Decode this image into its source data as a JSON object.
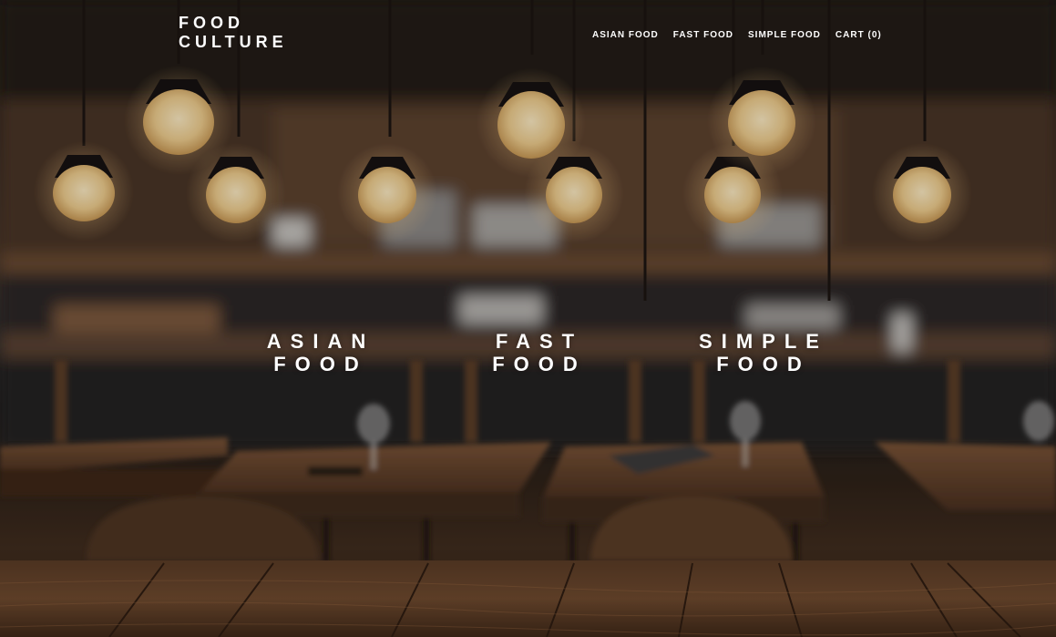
{
  "brand": {
    "line1": "FOOD",
    "line2": "CULTURE"
  },
  "nav": {
    "items": [
      {
        "label": "ASIAN FOOD"
      },
      {
        "label": "FAST FOOD"
      },
      {
        "label": "SIMPLE FOOD"
      }
    ],
    "cart_label": "CART",
    "cart_count": "0"
  },
  "categories": [
    {
      "line1": "ASIAN",
      "line2": "FOOD"
    },
    {
      "line1": "FAST",
      "line2": "FOOD"
    },
    {
      "line1": "SIMPLE",
      "line2": "FOOD"
    }
  ],
  "colors": {
    "text": "#ffffff",
    "lamp_glow": "#f3d9a0",
    "wood": "#6b4a30"
  }
}
